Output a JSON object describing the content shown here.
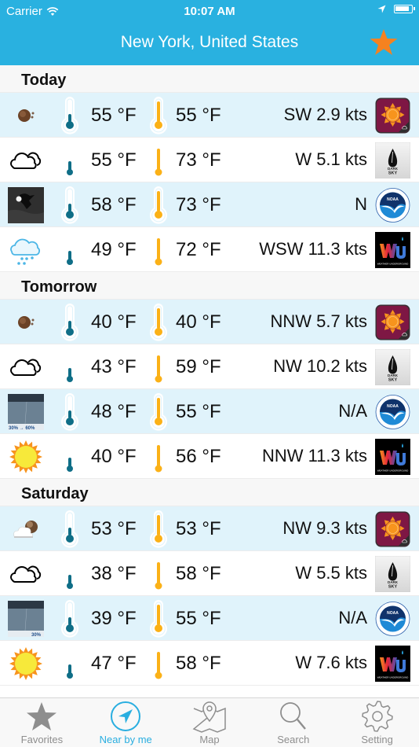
{
  "status_bar": {
    "carrier": "Carrier",
    "time": "10:07 AM",
    "wifi_icon": "wifi-icon",
    "location_icon": "location-arrow-icon",
    "battery_icon": "battery-icon"
  },
  "header": {
    "title": "New York, United States",
    "favorite_icon": "star-icon",
    "favorite_color": "#f58220",
    "bg_color": "#29b1e0"
  },
  "sections": [
    {
      "label": "Today",
      "rows": [
        {
          "condition": "partly-cloudy-moon",
          "low": "55 °F",
          "high": "55 °F",
          "wind": "SW 2.9 kts",
          "source": "Clear Weather Map",
          "full_thermo": true
        },
        {
          "condition": "cloudy-outline",
          "low": "55 °F",
          "high": "73 °F",
          "wind": "W 5.1 kts",
          "source": "Dark Sky",
          "full_thermo": false
        },
        {
          "condition": "night-photo",
          "low": "58 °F",
          "high": "73 °F",
          "wind": "N",
          "source": "NOAA",
          "full_thermo": true
        },
        {
          "condition": "rain-cloud",
          "low": "49 °F",
          "high": "72 °F",
          "wind": "WSW 11.3 kts",
          "source": "Weather Underground",
          "full_thermo": false
        }
      ]
    },
    {
      "label": "Tomorrow",
      "rows": [
        {
          "condition": "partly-cloudy-moon",
          "low": "40 °F",
          "high": "40 °F",
          "wind": "NNW 5.7 kts",
          "source": "Clear Weather Map",
          "full_thermo": true
        },
        {
          "condition": "cloudy-outline",
          "low": "43 °F",
          "high": "59 °F",
          "wind": "NW 10.2 kts",
          "source": "Dark Sky",
          "full_thermo": false
        },
        {
          "condition": "rain-photo",
          "photo_caption": "30% → 60%",
          "low": "48 °F",
          "high": "55 °F",
          "wind": "N/A",
          "source": "NOAA",
          "full_thermo": true
        },
        {
          "condition": "sunny",
          "low": "40 °F",
          "high": "56 °F",
          "wind": "NNW 11.3 kts",
          "source": "Weather Underground",
          "full_thermo": false
        }
      ]
    },
    {
      "label": "Saturday",
      "rows": [
        {
          "condition": "cloud-moon",
          "low": "53 °F",
          "high": "53 °F",
          "wind": "NW 9.3 kts",
          "source": "Clear Weather Map",
          "full_thermo": true
        },
        {
          "condition": "cloudy-outline",
          "low": "38 °F",
          "high": "58 °F",
          "wind": "W 5.5 kts",
          "source": "Dark Sky",
          "full_thermo": false
        },
        {
          "condition": "rain-photo",
          "photo_caption": "30%",
          "low": "39 °F",
          "high": "55 °F",
          "wind": "N/A",
          "source": "NOAA",
          "full_thermo": true
        },
        {
          "condition": "sunny",
          "low": "47 °F",
          "high": "58 °F",
          "wind": "W 7.6 kts",
          "source": "Weather Underground",
          "full_thermo": false
        }
      ]
    }
  ],
  "tabbar": {
    "items": [
      {
        "label": "Favorites",
        "icon": "star-icon",
        "active": false
      },
      {
        "label": "Near by me",
        "icon": "navigation-arrow-icon",
        "active": true
      },
      {
        "label": "Map",
        "icon": "map-icon",
        "active": false
      },
      {
        "label": "Search",
        "icon": "search-icon",
        "active": false
      },
      {
        "label": "Setting",
        "icon": "gear-icon",
        "active": false
      }
    ]
  },
  "colors": {
    "accent": "#29b1e0",
    "row_alt": "#e0f3fb",
    "thermo_low": "#0f6e87",
    "thermo_high": "#fbb117"
  }
}
